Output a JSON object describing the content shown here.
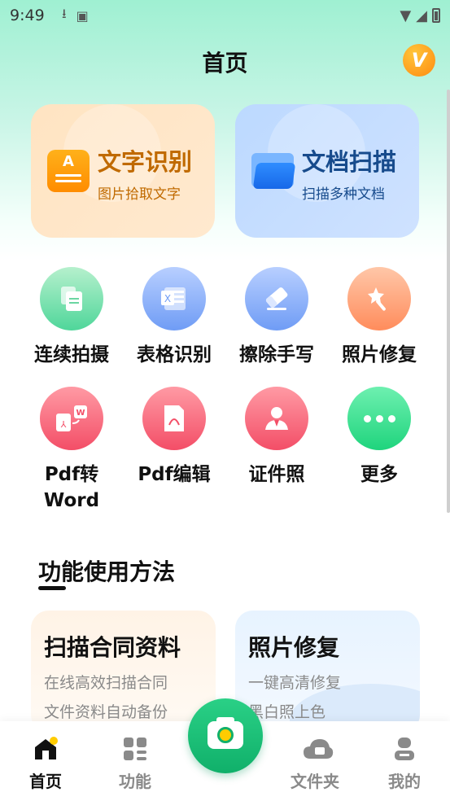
{
  "status_bar": {
    "time": "9:49"
  },
  "header": {
    "title": "首页",
    "vip_letter": "V"
  },
  "feature_cards": [
    {
      "title": "文字识别",
      "subtitle": "图片拾取文字",
      "icon": "text-recognition-icon",
      "icon_letter": "A"
    },
    {
      "title": "文档扫描",
      "subtitle": "扫描多种文档",
      "icon": "folder-icon"
    }
  ],
  "tools": [
    {
      "label": "连续拍摄",
      "icon": "copy-documents-icon"
    },
    {
      "label": "表格识别",
      "icon": "excel-icon",
      "icon_text": "X"
    },
    {
      "label": "擦除手写",
      "icon": "eraser-icon"
    },
    {
      "label": "照片修复",
      "icon": "magic-wand-icon"
    },
    {
      "label": "Pdf转\nWord",
      "label_line1": "Pdf转",
      "label_line2": "Word",
      "icon": "pdf-to-word-icon",
      "icon_text": "W"
    },
    {
      "label": "Pdf编辑",
      "icon": "pdf-edit-icon"
    },
    {
      "label": "证件照",
      "icon": "id-photo-icon"
    },
    {
      "label": "更多",
      "icon": "more-icon"
    }
  ],
  "usage_section": {
    "title": "功能使用方法",
    "cards": [
      {
        "title": "扫描合同资料",
        "line1": "在线高效扫描合同",
        "line2": "文件资料自动备份"
      },
      {
        "title": "照片修复",
        "line1": "一键高清修复",
        "line2": "黑白照上色"
      }
    ]
  },
  "bottom_nav": [
    {
      "label": "首页",
      "icon": "home-icon",
      "active": true
    },
    {
      "label": "功能",
      "icon": "grid-icon",
      "active": false
    },
    {
      "label": "文件夹",
      "icon": "cloud-folder-icon",
      "active": false
    },
    {
      "label": "我的",
      "icon": "user-icon",
      "active": false
    }
  ],
  "colors": {
    "accent": "#1fc27a",
    "ocr_card": "#ffe4c2",
    "scan_card": "#bcd9ff"
  }
}
